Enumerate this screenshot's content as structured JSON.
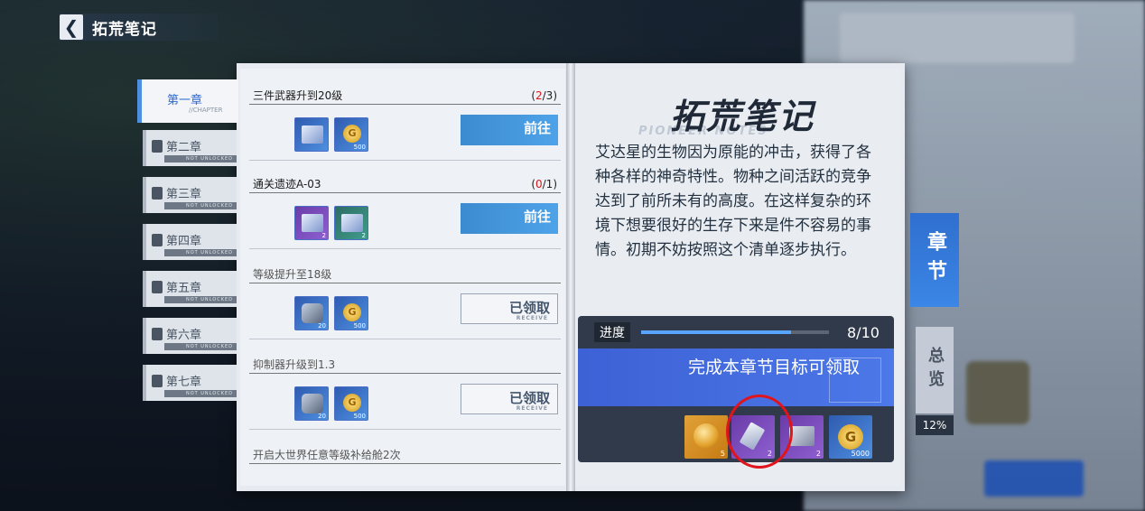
{
  "header": {
    "back_icon": "chevron-left-icon",
    "title": "拓荒笔记"
  },
  "tabs": [
    {
      "label": "第一章",
      "sub": "//CHAPTER",
      "locked": false
    },
    {
      "label": "第二章",
      "sub": "NOT UNLOCKED",
      "locked": true
    },
    {
      "label": "第三章",
      "sub": "NOT UNLOCKED",
      "locked": true
    },
    {
      "label": "第四章",
      "sub": "NOT UNLOCKED",
      "locked": true
    },
    {
      "label": "第五章",
      "sub": "NOT UNLOCKED",
      "locked": true
    },
    {
      "label": "第六章",
      "sub": "NOT UNLOCKED",
      "locked": true
    },
    {
      "label": "第七章",
      "sub": "NOT UNLOCKED",
      "locked": true
    }
  ],
  "tasks": [
    {
      "title": "三件武器升到20级",
      "count_open": "(",
      "count_done": "2",
      "count_total": "/3)",
      "rewards": [
        {
          "icon": "box-icon",
          "qty": ""
        },
        {
          "icon": "gold-coin-icon",
          "qty": "500",
          "glyph": "G"
        }
      ],
      "button": "前往",
      "button_sub": ""
    },
    {
      "title": "通关遗迹A-03",
      "count_open": "(",
      "count_done": "0",
      "count_total": "/1)",
      "rewards": [
        {
          "icon": "purple-crate-icon",
          "qty": "2"
        },
        {
          "icon": "green-crate-icon",
          "qty": "2"
        }
      ],
      "button": "前往",
      "button_sub": ""
    },
    {
      "title": "等级提升至18级",
      "rewards": [
        {
          "icon": "gear-icon",
          "qty": "20"
        },
        {
          "icon": "gold-coin-icon",
          "qty": "500",
          "glyph": "G"
        }
      ],
      "button": "已领取",
      "button_sub": "RECEIVE"
    },
    {
      "title": "抑制器升级到1.3",
      "rewards": [
        {
          "icon": "gear-icon",
          "qty": "20"
        },
        {
          "icon": "gold-coin-icon",
          "qty": "500",
          "glyph": "G"
        }
      ],
      "button": "已领取",
      "button_sub": "RECEIVE"
    },
    {
      "title": "开启大世界任意等级补给舱2次"
    }
  ],
  "notes": {
    "title": "拓荒笔记",
    "subtitle": "PIONEER NOTES",
    "description": "艾达星的生物因为原能的冲击，获得了各种各样的神奇特性。物种之间活跃的竞争达到了前所未有的高度。在这样复杂的环境下想要很好的生存下来是件不容易的事情。初期不妨按照这个清单逐步执行。"
  },
  "progress": {
    "label": "进度",
    "value": "8/10",
    "fraction": 0.8,
    "claim_text": "完成本章节目标可领取",
    "rewards": [
      {
        "icon": "gold-orb-icon",
        "qty": "5"
      },
      {
        "icon": "chip-icon",
        "qty": "2"
      },
      {
        "icon": "crate-icon",
        "qty": "2"
      },
      {
        "icon": "gold-coin-icon",
        "qty": "5000",
        "glyph": "G"
      }
    ]
  },
  "side": {
    "chapter_tab": "章节",
    "overview_tab": "总览",
    "overview_pct": "12%"
  },
  "colors": {
    "accent": "#4e8fe0",
    "highlight_circle": "#e0141c",
    "done_count": "#d01a1a"
  }
}
